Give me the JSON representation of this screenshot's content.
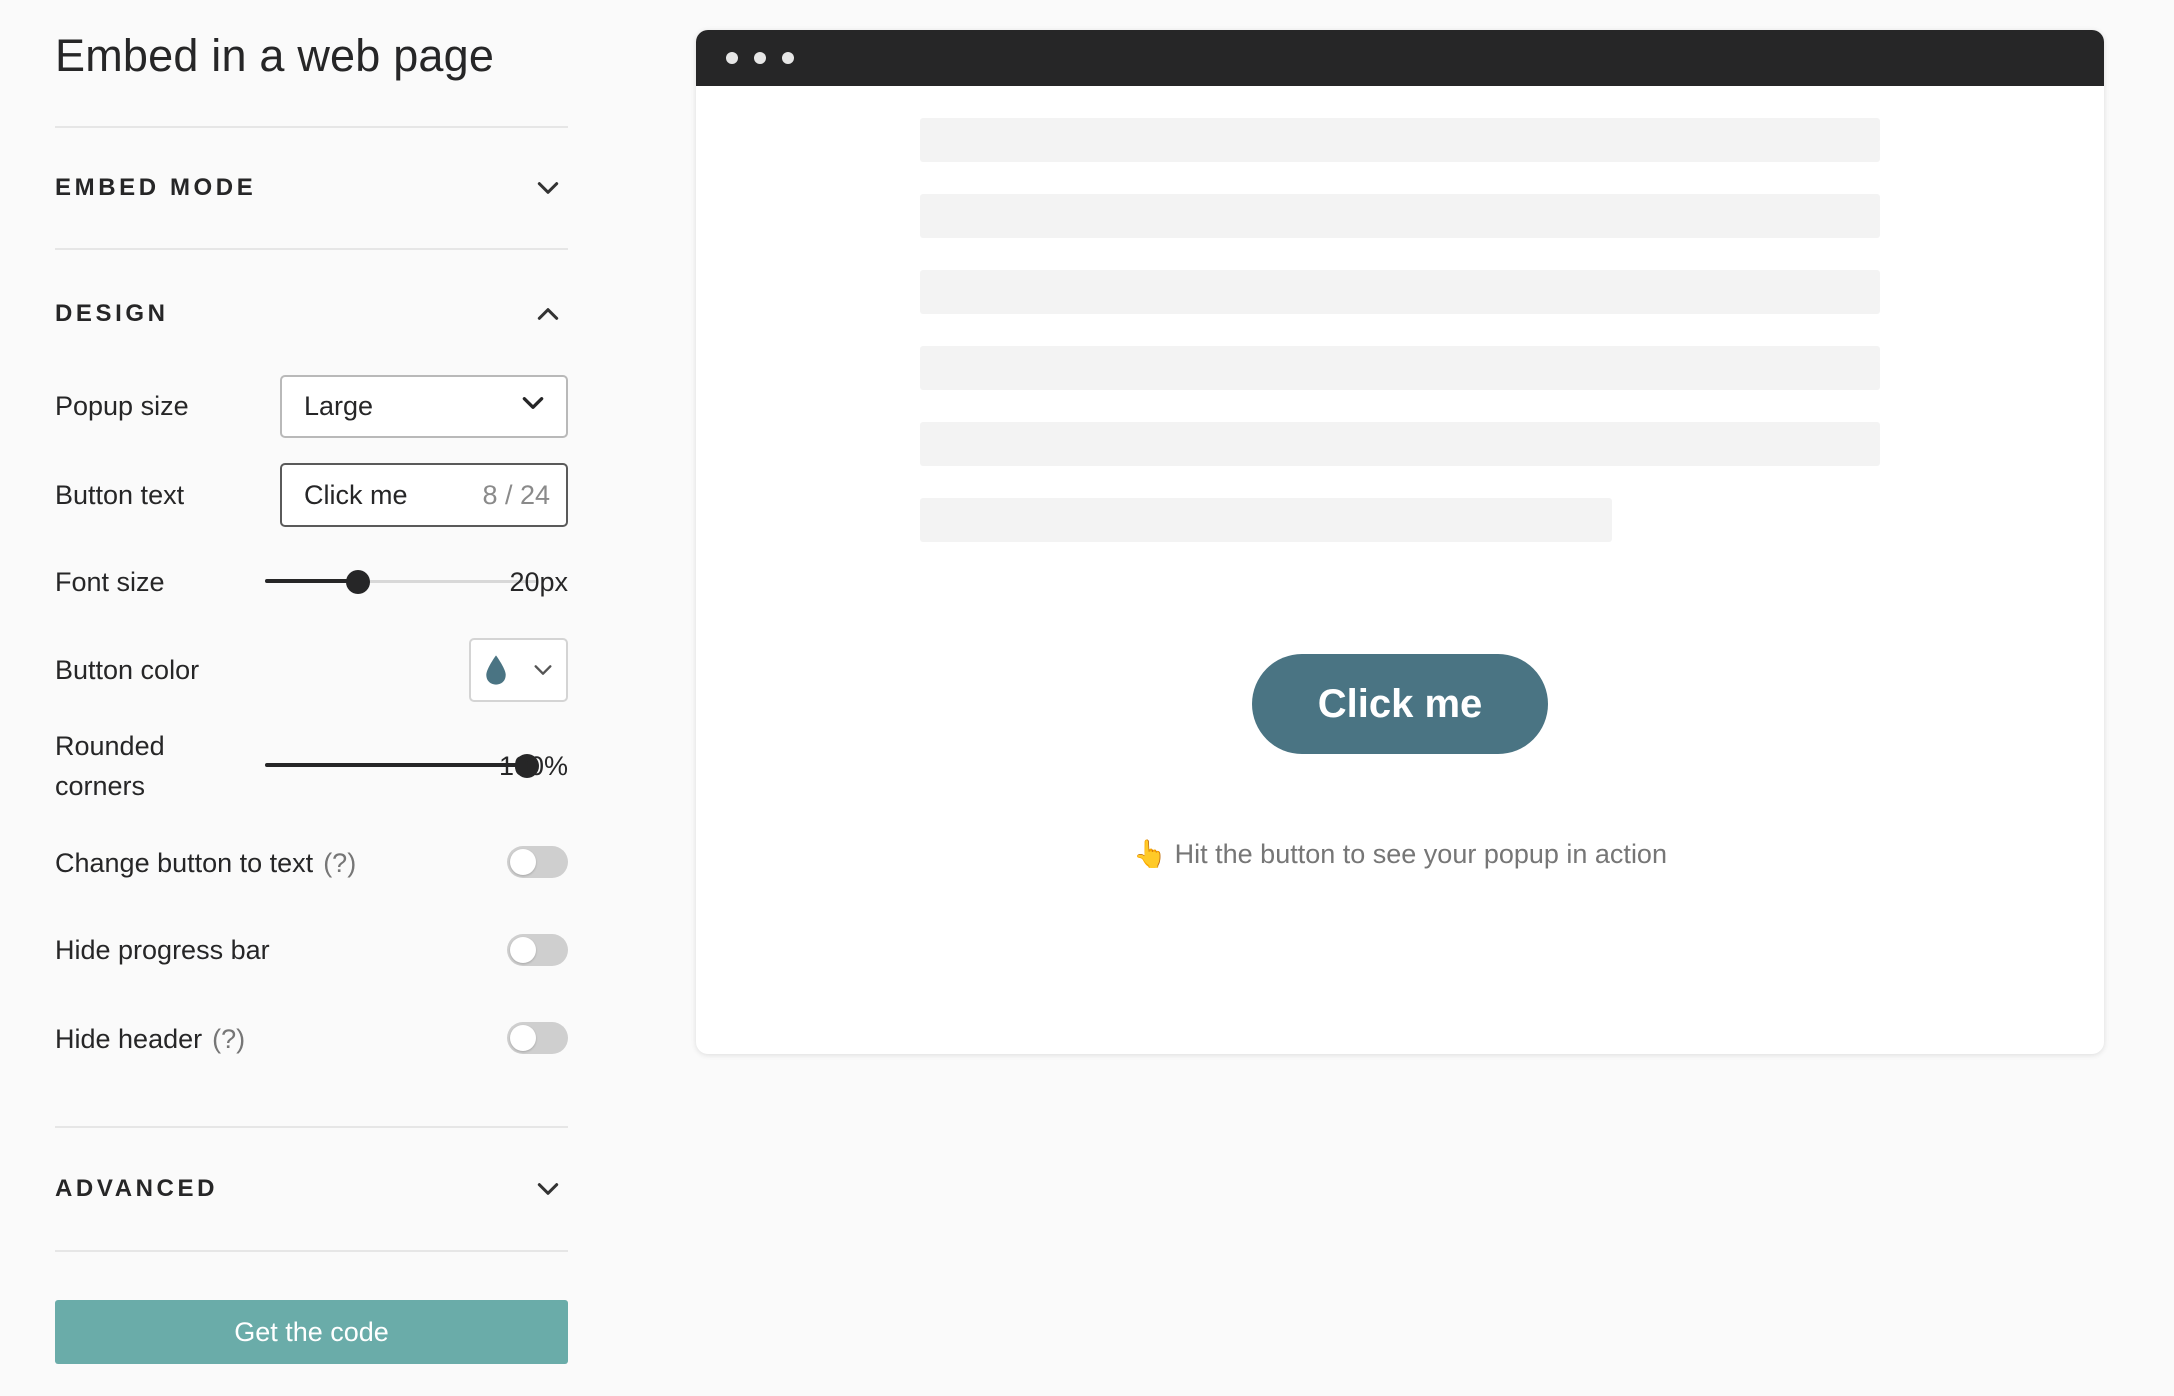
{
  "sidebar": {
    "title": "Embed in a web page",
    "sections": {
      "embed_mode": {
        "label": "EMBED MODE",
        "expanded": false
      },
      "design": {
        "label": "DESIGN",
        "expanded": true
      },
      "advanced": {
        "label": "ADVANCED",
        "expanded": false
      }
    },
    "design": {
      "popup_size": {
        "label": "Popup size",
        "value": "Large"
      },
      "button_text": {
        "label": "Button text",
        "value": "Click me",
        "counter": "8 / 24"
      },
      "font_size": {
        "label": "Font size",
        "value": "20px",
        "fraction": 0.34
      },
      "button_color": {
        "label": "Button color",
        "color": "#4a7483"
      },
      "rounded_corners": {
        "label_line1": "Rounded",
        "label_line2": "corners",
        "value": "100%",
        "fraction": 1.0
      },
      "change_button_to_text": {
        "label": "Change button to text",
        "help": "(?)",
        "on": false
      },
      "hide_progress_bar": {
        "label": "Hide progress bar",
        "on": false
      },
      "hide_header": {
        "label": "Hide header",
        "help": "(?)",
        "on": false
      }
    },
    "cta_label": "Get the code"
  },
  "preview": {
    "button_label": "Click me",
    "hint_emoji": "👆",
    "hint": "Hit the button to see your popup in action"
  },
  "colors": {
    "accent": "#6aaca9",
    "button": "#4a7483",
    "browser_bar": "#262627"
  }
}
